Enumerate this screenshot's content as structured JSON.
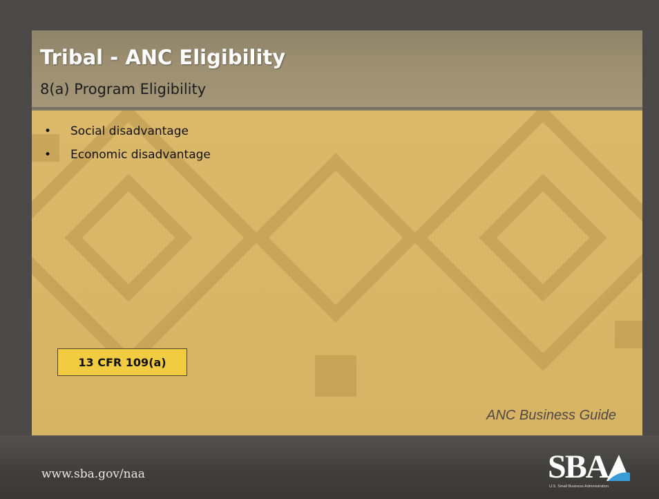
{
  "slide": {
    "title": "Tribal - ANC Eligibility",
    "subtitle": "8(a) Program Eligibility",
    "bullets": [
      {
        "label": "Social disadvantage"
      },
      {
        "label": "Economic disadvantage"
      }
    ],
    "bullet_symbol": "•",
    "citation": "13 CFR 109(a)",
    "guide_label": "ANC Business Guide"
  },
  "footer": {
    "url": "www.sba.gov/naa",
    "logo_text": "SBA",
    "logo_subtitle": "U.S. Small Business Administration"
  },
  "colors": {
    "panel": "#dbb767",
    "title_bar": "#9d9073",
    "citation_box": "#f2cc40",
    "footer": "#3f3e3c",
    "logo_accent": "#3a9bd5"
  }
}
